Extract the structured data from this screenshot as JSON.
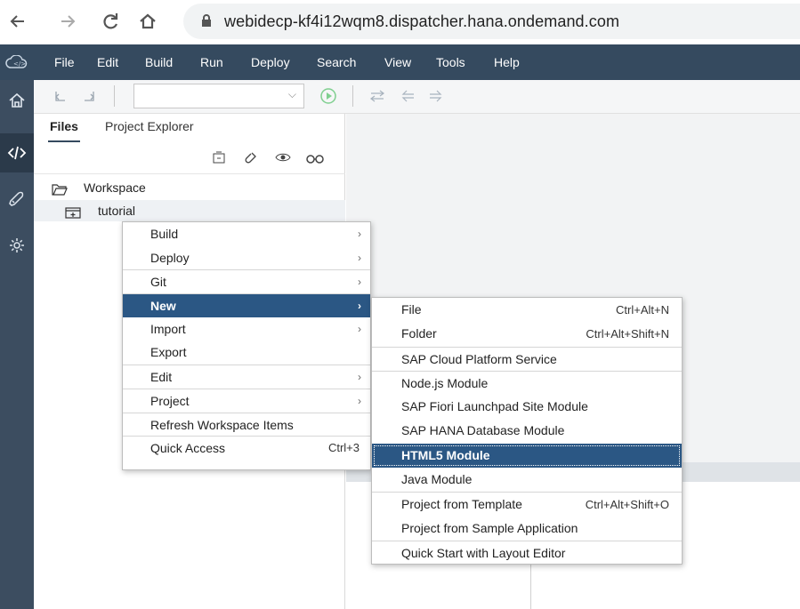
{
  "browser": {
    "url": "webidecp-kf4i12wqm8.dispatcher.hana.ondemand.com",
    "back_icon": "back-arrow-icon",
    "forward_icon": "forward-arrow-icon",
    "reload_icon": "reload-icon",
    "home_icon": "home-icon",
    "lock_icon": "lock-icon"
  },
  "menubar": {
    "items": [
      "File",
      "Edit",
      "Build",
      "Run",
      "Deploy",
      "Search",
      "View",
      "Tools",
      "Help"
    ]
  },
  "rail": {
    "icons": [
      "home-icon",
      "code-icon",
      "rocket-icon",
      "settings-icon"
    ]
  },
  "files_pane": {
    "tabs": [
      "Files",
      "Project Explorer"
    ],
    "tree": [
      {
        "label": "Workspace"
      },
      {
        "label": "tutorial"
      }
    ]
  },
  "context_menu": {
    "items": [
      {
        "label": "Build",
        "submenu": true
      },
      {
        "label": "Deploy",
        "submenu": true
      },
      {
        "label": "Git",
        "submenu": true
      },
      {
        "label": "New",
        "submenu": true,
        "highlighted": true
      },
      {
        "label": "Import",
        "submenu": true
      },
      {
        "label": "Export",
        "submenu": false
      },
      {
        "label": "Edit",
        "submenu": true
      },
      {
        "label": "Project",
        "submenu": true
      },
      {
        "label": "Refresh Workspace Items",
        "submenu": false
      },
      {
        "label": "Quick Access",
        "submenu": false,
        "shortcut": "Ctrl+3"
      }
    ]
  },
  "new_submenu": {
    "items": [
      {
        "label": "File",
        "shortcut": "Ctrl+Alt+N"
      },
      {
        "label": "Folder",
        "shortcut": "Ctrl+Alt+Shift+N"
      },
      {
        "label": "SAP Cloud Platform Service",
        "shortcut": ""
      },
      {
        "label": "Node.js Module",
        "shortcut": ""
      },
      {
        "label": "SAP Fiori Launchpad Site Module",
        "shortcut": ""
      },
      {
        "label": "SAP HANA Database Module",
        "shortcut": ""
      },
      {
        "label": "HTML5 Module",
        "shortcut": "",
        "highlighted": true
      },
      {
        "label": "Java Module",
        "shortcut": ""
      },
      {
        "label": "Project from Template",
        "shortcut": "Ctrl+Alt+Shift+O"
      },
      {
        "label": "Project from Sample Application",
        "shortcut": ""
      },
      {
        "label": "Quick Start with Layout Editor",
        "shortcut": ""
      }
    ]
  },
  "colors": {
    "shell": "#354a5f",
    "highlight": "#2b5784"
  }
}
